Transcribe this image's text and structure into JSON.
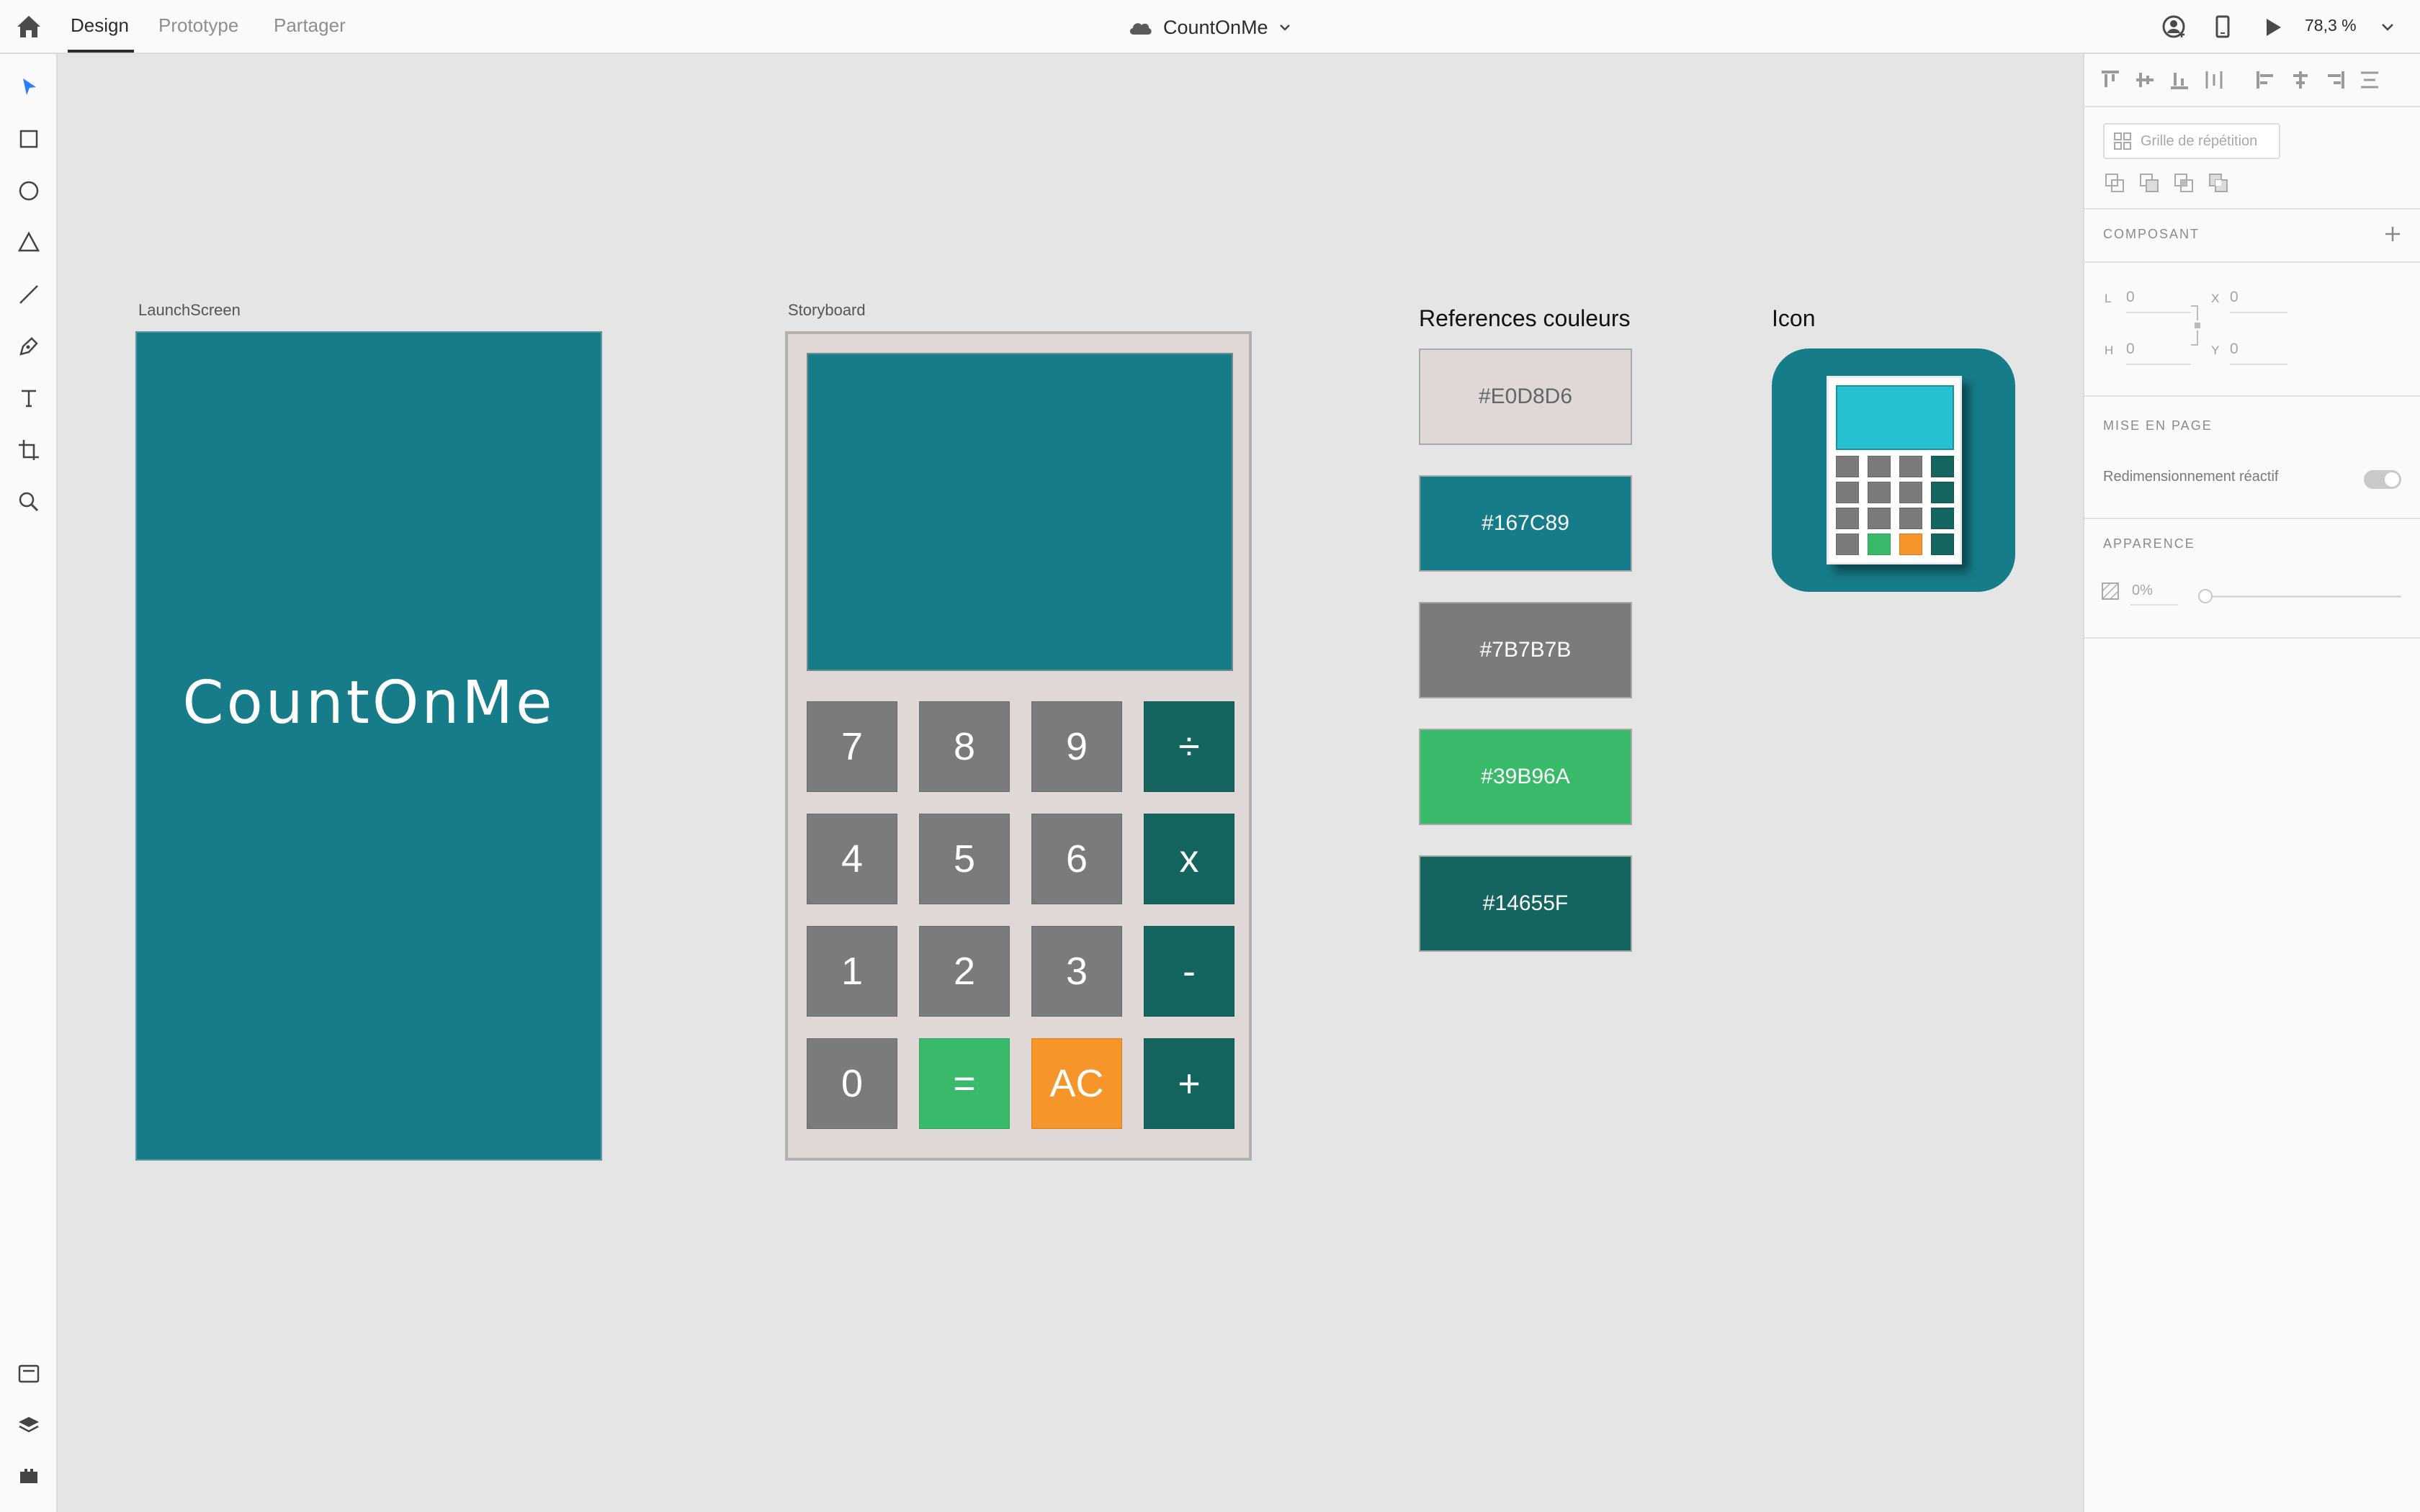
{
  "topbar": {
    "tabs": [
      {
        "label": "Design"
      },
      {
        "label": "Prototype"
      },
      {
        "label": "Partager"
      }
    ],
    "document_title": "CountOnMe",
    "zoom": "78,3 %"
  },
  "right_panel": {
    "repeat_grid_label": "Grille de répétition",
    "component_section": "COMPOSANT",
    "width_label": "L",
    "width_value": "0",
    "x_label": "X",
    "x_value": "0",
    "height_label": "H",
    "height_value": "0",
    "y_label": "Y",
    "y_value": "0",
    "layout_section": "MISE EN PAGE",
    "responsive_resize_label": "Redimensionnement réactif",
    "appearance_section": "APPARENCE",
    "opacity_value": "0%"
  },
  "canvas": {
    "launch_label": "LaunchScreen",
    "launch_text": "CountOnMe",
    "storyboard_label": "Storyboard",
    "keys": [
      "7",
      "8",
      "9",
      "÷",
      "4",
      "5",
      "6",
      "x",
      "1",
      "2",
      "3",
      "-",
      "0",
      "=",
      "AC",
      "+"
    ],
    "colors_title": "References couleurs",
    "swatches": [
      {
        "label": "#E0D8D6",
        "color": "#E0D8D6"
      },
      {
        "label": "#167C89",
        "color": "#167C89"
      },
      {
        "label": "#7B7B7B",
        "color": "#7B7B7B"
      },
      {
        "label": "#39B96A",
        "color": "#39B96A"
      },
      {
        "label": "#14655F",
        "color": "#14655F"
      }
    ],
    "icon_title": "Icon"
  },
  "icons": {
    "left_tools": [
      "select-arrow-icon",
      "rectangle-icon",
      "ellipse-icon",
      "polygon-icon",
      "line-icon",
      "pen-icon",
      "text-icon",
      "artboard-icon",
      "zoom-icon"
    ],
    "left_bottom": [
      "assets-icon",
      "layers-icon",
      "plugins-icon"
    ],
    "top_right": [
      "user-icon",
      "device-preview-icon",
      "play-icon",
      "chevron-down-icon"
    ]
  }
}
